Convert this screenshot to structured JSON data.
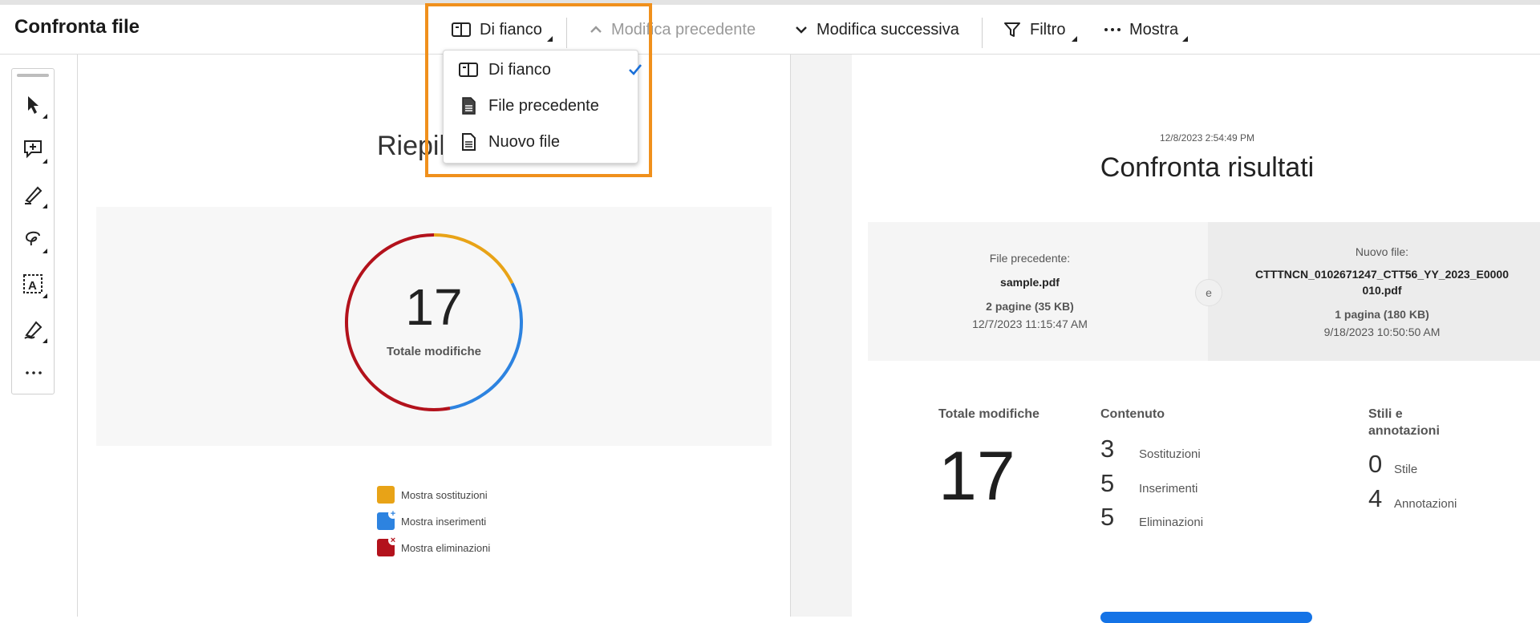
{
  "app": {
    "title": "Confronta file"
  },
  "toolbar": {
    "view_label": "Di fianco",
    "prev_change_label": "Modifica precedente",
    "next_change_label": "Modifica successiva",
    "filter_label": "Filtro",
    "show_label": "Mostra"
  },
  "view_menu": {
    "items": [
      {
        "label": "Di fianco",
        "icon": "side-by-side-icon",
        "selected": true
      },
      {
        "label": "File precedente",
        "icon": "file-filled-icon",
        "selected": false
      },
      {
        "label": "Nuovo file",
        "icon": "file-outline-icon",
        "selected": false
      }
    ]
  },
  "sidebar": {
    "tools": [
      "select-arrow-icon",
      "add-comment-icon",
      "highlighter-icon",
      "lasso-draw-icon",
      "text-recognition-icon",
      "sign-pen-icon",
      "more-options-icon"
    ]
  },
  "left_page": {
    "heading": "Riepil",
    "total": "17",
    "total_label": "Totale modifiche",
    "donut_segments": [
      {
        "name": "sostituzioni",
        "count": 3,
        "color": "#e8a317"
      },
      {
        "name": "inserimenti",
        "count": 5,
        "color": "#2d83e0"
      },
      {
        "name": "eliminazioni",
        "count": 9,
        "color": "#b3121c"
      }
    ],
    "legend": [
      {
        "label": "Mostra sostituzioni",
        "color": "#e8a317"
      },
      {
        "label": "Mostra inserimenti",
        "color": "#2d83e0"
      },
      {
        "label": "Mostra eliminazioni",
        "color": "#b3121c"
      }
    ]
  },
  "right_page": {
    "timestamp": "12/8/2023 2:54:49 PM",
    "title": "Confronta risultati",
    "old_file": {
      "label": "File precedente:",
      "name": "sample.pdf",
      "pages": "2 pagine (35 KB)",
      "date": "12/7/2023 11:15:47 AM"
    },
    "connector": "e",
    "new_file": {
      "label": "Nuovo file:",
      "name_line1": "CTTTNCN_0102671247_CTT56_YY_2023_E0000",
      "name_line2": "010.pdf",
      "pages": "1 pagina (180 KB)",
      "date": "9/18/2023 10:50:50 AM"
    },
    "stats": {
      "total_label": "Totale modifiche",
      "total": "17",
      "content_label": "Contenuto",
      "replacements": "3",
      "replacements_label": "Sostituzioni",
      "insertions": "5",
      "insertions_label": "Inserimenti",
      "deletions": "5",
      "deletions_label": "Eliminazioni",
      "styles_label_line1": "Stili e",
      "styles_label_line2": "annotazioni",
      "style_count": "0",
      "style_label": "Stile",
      "annotation_count": "4",
      "annotation_label": "Annotazioni"
    }
  },
  "colors": {
    "accent_highlight": "#f0901c",
    "primary_blue": "#1473e6",
    "check_blue": "#1a6fd8"
  }
}
